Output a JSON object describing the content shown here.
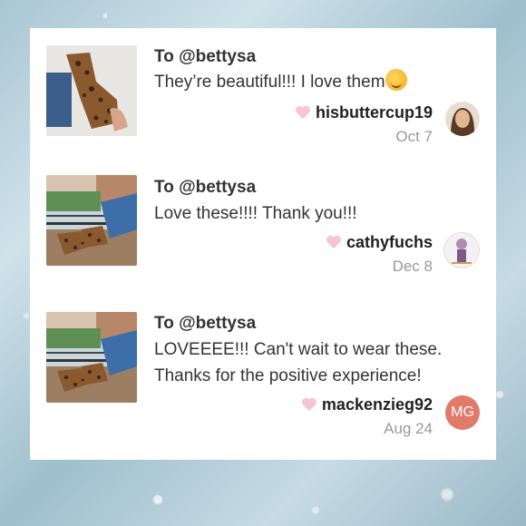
{
  "reviews": [
    {
      "to": "To @bettysa",
      "message": "They’re beautiful!!! I love them",
      "emoji": "smiling-face-with-hearts-emoji",
      "username": "hisbuttercup19",
      "date": "Oct 7",
      "avatar": "photo"
    },
    {
      "to": "To @bettysa",
      "message": "Love these!!!! Thank you!!!",
      "username": "cathyfuchs",
      "date": "Dec 8",
      "avatar": "photo"
    },
    {
      "to": "To @bettysa",
      "message_line1": "LOVEEEE!!! Can't wait to wear these.",
      "message_line2": "Thanks for the positive experience!",
      "username": "mackenzieg92",
      "date": "Aug 24",
      "avatar_initials": "MG"
    }
  ],
  "colors": {
    "heart": "#f7c5cf",
    "avatar_initials_bg": "#e07a6a",
    "date": "#999999"
  }
}
